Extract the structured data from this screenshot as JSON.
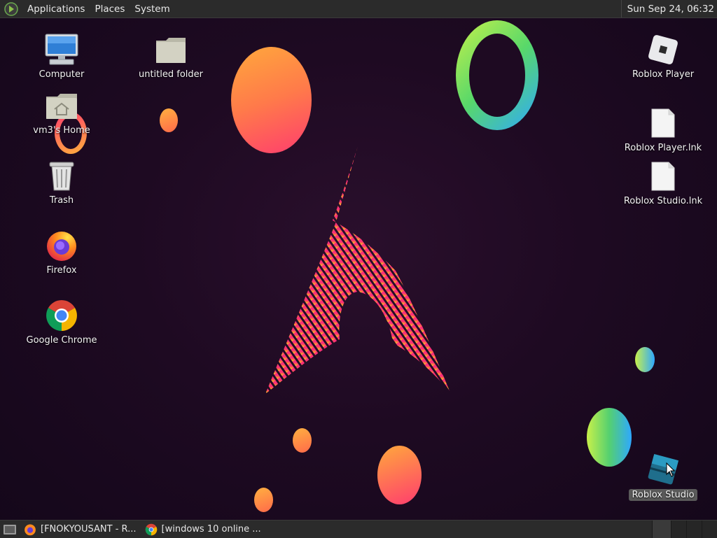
{
  "top_panel": {
    "menus": [
      "Applications",
      "Places",
      "System"
    ],
    "clock": "Sun Sep 24, 06:32"
  },
  "desktop": {
    "icons": {
      "computer": "Computer",
      "folder": "untitled folder",
      "home": "vm3's Home",
      "trash": "Trash",
      "firefox": "Firefox",
      "chrome": "Google Chrome",
      "roblox_player": "Roblox Player",
      "roblox_player_lnk": "Roblox Player.lnk",
      "roblox_studio_lnk": "Roblox Studio.lnk",
      "roblox_studio": "Roblox Studio"
    }
  },
  "taskbar": {
    "tasks": [
      {
        "label": "[FNOKYOUSANT - R...",
        "icon": "firefox-icon"
      },
      {
        "label": "[windows 10 online ...",
        "icon": "chrome-icon"
      }
    ]
  },
  "colors": {
    "panel": "#2b2b2b",
    "background": "#1e0a22",
    "accent_pink": "#ff2f78",
    "accent_orange": "#ffa23a"
  }
}
